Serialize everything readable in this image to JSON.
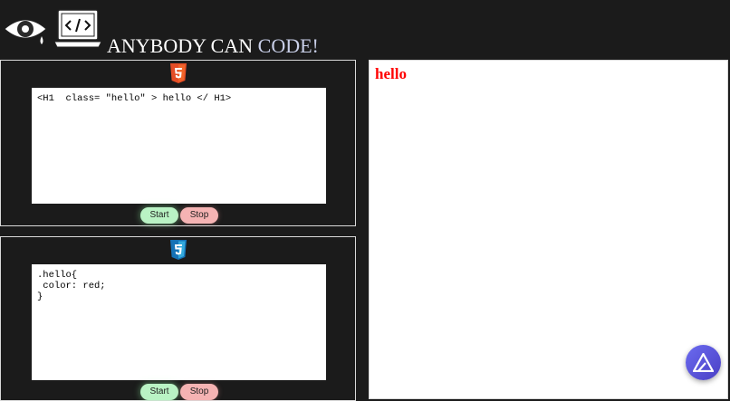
{
  "header": {
    "title_main": "ANYBODY CAN ",
    "title_accent": "CODE!"
  },
  "icons": {
    "eye": "eye-icon",
    "laptop": "laptop-code-icon",
    "html": "html5-icon",
    "css": "css3-icon",
    "assistant": "assistant-icon"
  },
  "html_panel": {
    "code": "<H1  class= \"hello\" > hello </ H1>",
    "start_label": "Start",
    "stop_label": "Stop"
  },
  "css_panel": {
    "code": ".hello{\n color: red;\n}",
    "start_label": "Start",
    "stop_label": "Stop"
  },
  "preview": {
    "heading": "hello"
  },
  "colors": {
    "background": "#1b1b1b",
    "html_badge": "#e44d26",
    "css_badge": "#1572b6",
    "start": "#b9f3c4",
    "stop": "#f5b3b3",
    "preview_text": "#ff0000"
  }
}
